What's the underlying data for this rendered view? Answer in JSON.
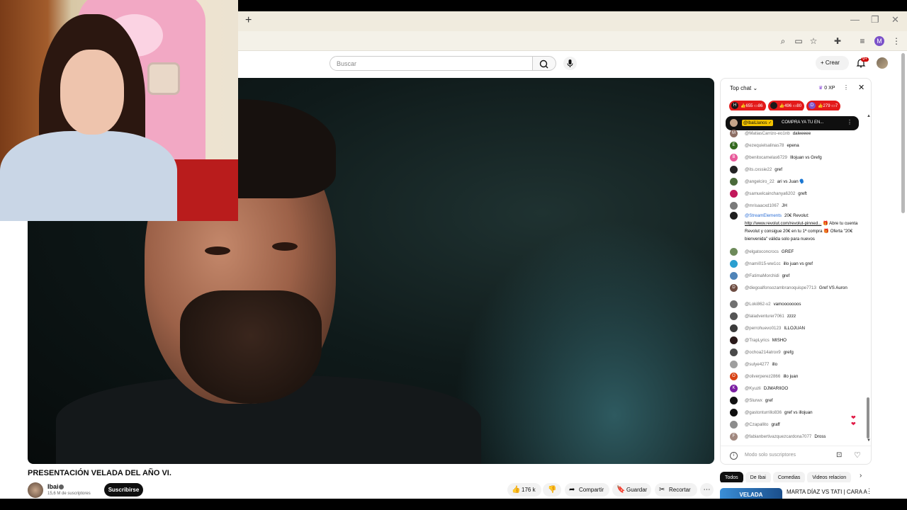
{
  "browser": {
    "new_tab": "+",
    "minimize": "—",
    "restore": "❐",
    "close": "✕",
    "profile_initial": "M"
  },
  "header": {
    "search_placeholder": "Buscar",
    "create_label": "Crear",
    "notification_count": "9+"
  },
  "video": {
    "title": "PRESENTACIÓN VELADA DEL AÑO VI.",
    "channel_name": "Ibai",
    "subscribers": "15,6 M de suscriptores",
    "subscribe_label": "Suscribirse",
    "likes": "176 k",
    "share_label": "Compartir",
    "save_label": "Guardar",
    "clip_label": "Recortar"
  },
  "chat": {
    "mode_label": "Top chat",
    "xp": "0 XP",
    "pills": [
      {
        "avatar": "H",
        "likes": "655",
        "comments": "86"
      },
      {
        "avatar": "",
        "likes": "496",
        "comments": "80"
      },
      {
        "avatar": "D",
        "likes": "279",
        "comments": "7"
      }
    ],
    "pinned": {
      "user": "@IbaiLlanos",
      "text": "COMPRA YA TU EN..."
    },
    "messages": [
      {
        "initial": "M",
        "color": "#8d6e63",
        "user": "@MatiasCarrizo-eo1nb",
        "text": "daleeeee"
      },
      {
        "initial": "E",
        "color": "#33691e",
        "user": "@ezequielsalinas78",
        "text": "epena"
      },
      {
        "initial": "B",
        "color": "#e85a9a",
        "user": "@benitocamelas6729",
        "text": "Illojuan vs Grefg"
      },
      {
        "initial": "",
        "color": "#222222",
        "user": "@its.cxssie22",
        "text": "gref"
      },
      {
        "initial": "",
        "color": "#4a6a3a",
        "user": "@angelciro_22",
        "text": "ari vs Juan 🗣️"
      },
      {
        "initial": "",
        "color": "#c2185b",
        "user": "@samuelcainchanya6202",
        "text": "greft"
      },
      {
        "initial": "",
        "color": "#7a7a7a",
        "user": "@mrisaacxd1067",
        "text": "JH"
      },
      {
        "initial": "",
        "color": "#1f1f1f",
        "user": "@StreamElements",
        "text": "20€ Revolut:",
        "link": "http://www.revolut.com/revolut-pinned...",
        "text2": "🎁 Abre tu cuenta Revolut y consigue 20€ en tu 1ª compra 🎁 Oferta \"20€ bienvenida\" válida solo para nuevos"
      },
      {
        "initial": "",
        "color": "#6d8a5a",
        "user": "@elgatoconcrocs",
        "text": "GREF"
      },
      {
        "initial": "",
        "color": "#2a9fd0",
        "user": "@nami015-ww1cc",
        "text": "illo juan vs gref"
      },
      {
        "initial": "",
        "color": "#4f84b8",
        "user": "@FatimaMorchidi",
        "text": "gref"
      },
      {
        "initial": "D",
        "color": "#6d4c41",
        "user": "@diegoalfonsozambranoquispe7713",
        "text": "Gref VS Auron"
      },
      {
        "initial": "",
        "color": "#707070",
        "user": "@Loki862-v2",
        "text": "vamooooooos"
      },
      {
        "initial": "",
        "color": "#555555",
        "user": "@laladventurer7061",
        "text": "zzzz"
      },
      {
        "initial": "",
        "color": "#3b3b3b",
        "user": "@perrohuevo0123",
        "text": "ILLOJUAN"
      },
      {
        "initial": "",
        "color": "#2a1a1a",
        "user": "@TrapLyrics",
        "text": "MISHO"
      },
      {
        "initial": "",
        "color": "#4a4a4a",
        "user": "@ochoa214atrox9",
        "text": "grefg"
      },
      {
        "initial": "",
        "color": "#9e9e9e",
        "user": "@sulye4277",
        "text": "illo"
      },
      {
        "initial": "O",
        "color": "#d84315",
        "user": "@oliverperez2866",
        "text": "illo juan"
      },
      {
        "initial": "K",
        "color": "#7b1fa2",
        "user": "@Kyuzli",
        "text": "DJMARIIOO"
      },
      {
        "initial": "",
        "color": "#111111",
        "user": "@Slurwx",
        "text": "gref"
      },
      {
        "initial": "",
        "color": "#0f0f0f",
        "user": "@gastonturrillo836",
        "text": "gref vs illojuan"
      },
      {
        "initial": "",
        "color": "#8c8c8c",
        "user": "@Czapallito",
        "text": "graff"
      },
      {
        "initial": "F",
        "color": "#a1887f",
        "user": "@fabianbertivazquezcardona7077",
        "text": "Dross"
      }
    ],
    "input_placeholder": "Modo solo suscriptores"
  },
  "chips": [
    "Todos",
    "De Ibai",
    "Comedias",
    "Videos relacion"
  ],
  "recommended": {
    "thumb_text": "VELADA",
    "title": "MARTA DÍAZ VS TATI | CARA A"
  },
  "colors": {
    "accent_red": "#e31a1a",
    "chip_active": "#0f0f0f",
    "pinned_tag": "#f2c200"
  }
}
